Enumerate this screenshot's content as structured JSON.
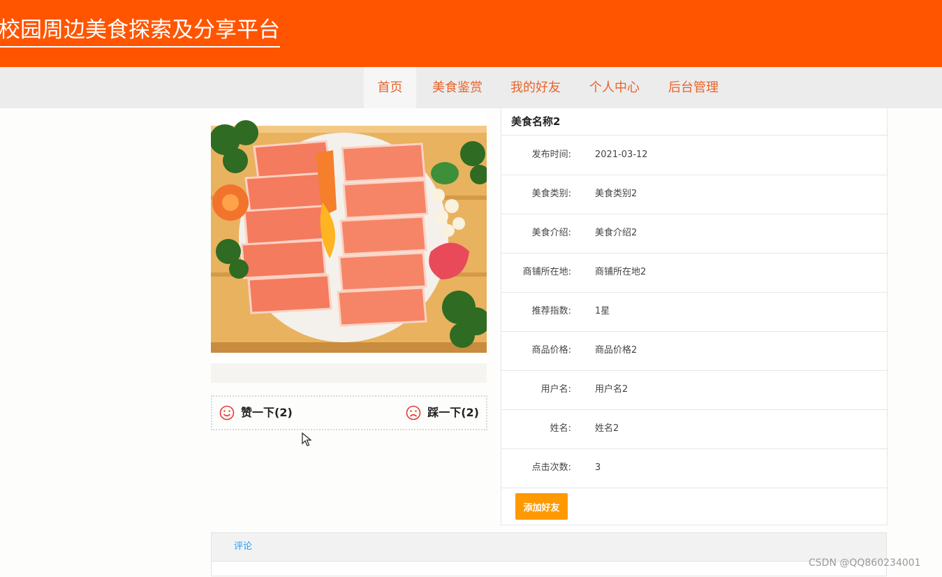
{
  "header": {
    "site_title": "校园周边美食探索及分享平台",
    "bg_color": "#ff5500"
  },
  "nav": {
    "items": [
      {
        "label": "首页",
        "active": true
      },
      {
        "label": "美食鉴赏"
      },
      {
        "label": "我的好友"
      },
      {
        "label": "个人中心"
      },
      {
        "label": "后台管理"
      }
    ],
    "text_color": "#e8632a"
  },
  "food": {
    "image_icon": "salmon-sashimi-photo",
    "like_label": "赞一下(2)",
    "dislike_label": "踩一下(2)",
    "like_icon": "smile-icon",
    "dislike_icon": "frown-icon"
  },
  "details": {
    "title": "美食名称2",
    "rows": [
      {
        "label": "发布时间:",
        "value": "2021-03-12"
      },
      {
        "label": "美食类别:",
        "value": "美食类别2"
      },
      {
        "label": "美食介绍:",
        "value": "美食介绍2"
      },
      {
        "label": "商铺所在地:",
        "value": "商铺所在地2"
      },
      {
        "label": "推荐指数:",
        "value": "1星"
      },
      {
        "label": "商品价格:",
        "value": "商品价格2"
      },
      {
        "label": "用户名:",
        "value": "用户名2"
      },
      {
        "label": "姓名:",
        "value": "姓名2"
      },
      {
        "label": "点击次数:",
        "value": "3"
      }
    ],
    "add_friend_label": "添加好友",
    "button_color": "#ff9900"
  },
  "comments": {
    "tab_label": "评论",
    "tab_color": "#1e9fff"
  },
  "watermark": "CSDN @QQ860234001"
}
